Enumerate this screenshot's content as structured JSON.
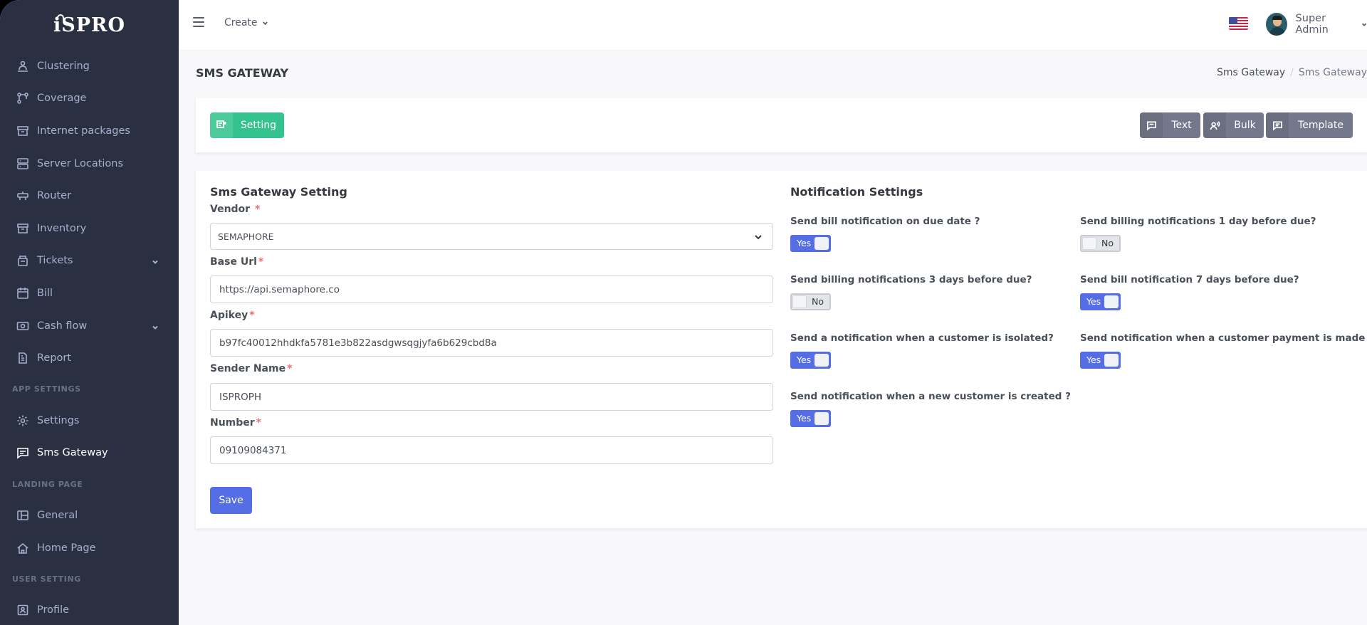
{
  "sidebar": {
    "logo": "iSPRO",
    "items_top": [
      {
        "label": "Clustering",
        "icon": "cluster-icon"
      },
      {
        "label": "Coverage",
        "icon": "coverage-icon"
      },
      {
        "label": "Internet packages",
        "icon": "package-icon"
      },
      {
        "label": "Server Locations",
        "icon": "server-icon"
      },
      {
        "label": "Router",
        "icon": "router-icon"
      },
      {
        "label": "Inventory",
        "icon": "inventory-icon"
      },
      {
        "label": "Tickets",
        "icon": "ticket-icon"
      },
      {
        "label": "Bill",
        "icon": "bill-icon"
      },
      {
        "label": "Cash flow",
        "icon": "cash-icon"
      },
      {
        "label": "Report",
        "icon": "report-icon"
      }
    ],
    "app_settings_title": "APP SETTINGS",
    "settings_label": "Settings",
    "sms_gateway_label": "Sms Gateway",
    "landing_page_title": "LANDING PAGE",
    "general_label": "General",
    "home_page_label": "Home Page",
    "user_setting_title": "USER SETTING",
    "profile_label": "Profile"
  },
  "topbar": {
    "create_label": "Create",
    "user_name": "Super Admin",
    "flag_icon": "us-flag-icon"
  },
  "page": {
    "title": "SMS GATEWAY",
    "breadcrumb": [
      "Sms Gateway",
      "Sms Gateway"
    ]
  },
  "actions": {
    "setting_label": "Setting",
    "text_label": "Text",
    "bulk_label": "Bulk",
    "template_label": "Template"
  },
  "form": {
    "title": "Sms Gateway Setting",
    "vendor_label": "Vendor",
    "vendor_value": "SEMAPHORE",
    "base_url_label": "Base Url",
    "base_url_value": "https://api.semaphore.co",
    "apikey_label": "Apikey",
    "apikey_value": "b97fc40012hhdkfa5781e3b822asdgwsqgjyfa6b629cbd8a",
    "sender_label": "Sender Name",
    "sender_value": "ISPROPH",
    "number_label": "Number",
    "number_value": "09109084371",
    "required_mark": "*",
    "save_label": "Save"
  },
  "notifications": {
    "title": "Notification Settings",
    "items": [
      {
        "label": "Send bill notification on due date ?",
        "state": "Yes",
        "on": true
      },
      {
        "label": "Send billing notifications 1 day before due?",
        "state": "No",
        "on": false
      },
      {
        "label": "Send billing notifications 3 days before due?",
        "state": "No",
        "on": false
      },
      {
        "label": "Send bill notification 7 days before due?",
        "state": "Yes",
        "on": true
      },
      {
        "label": "Send a notification when a customer is isolated?",
        "state": "Yes",
        "on": true
      },
      {
        "label": "Send notification when a customer payment is made ?",
        "state": "Yes",
        "on": true
      },
      {
        "label": "Send notification when a new customer is created ?",
        "state": "Yes",
        "on": true
      }
    ]
  },
  "colors": {
    "sidebar_bg": "#2a3042",
    "primary": "#556ee6",
    "success": "#34c38f",
    "secondary": "#74788d",
    "required": "#f46a6a"
  }
}
